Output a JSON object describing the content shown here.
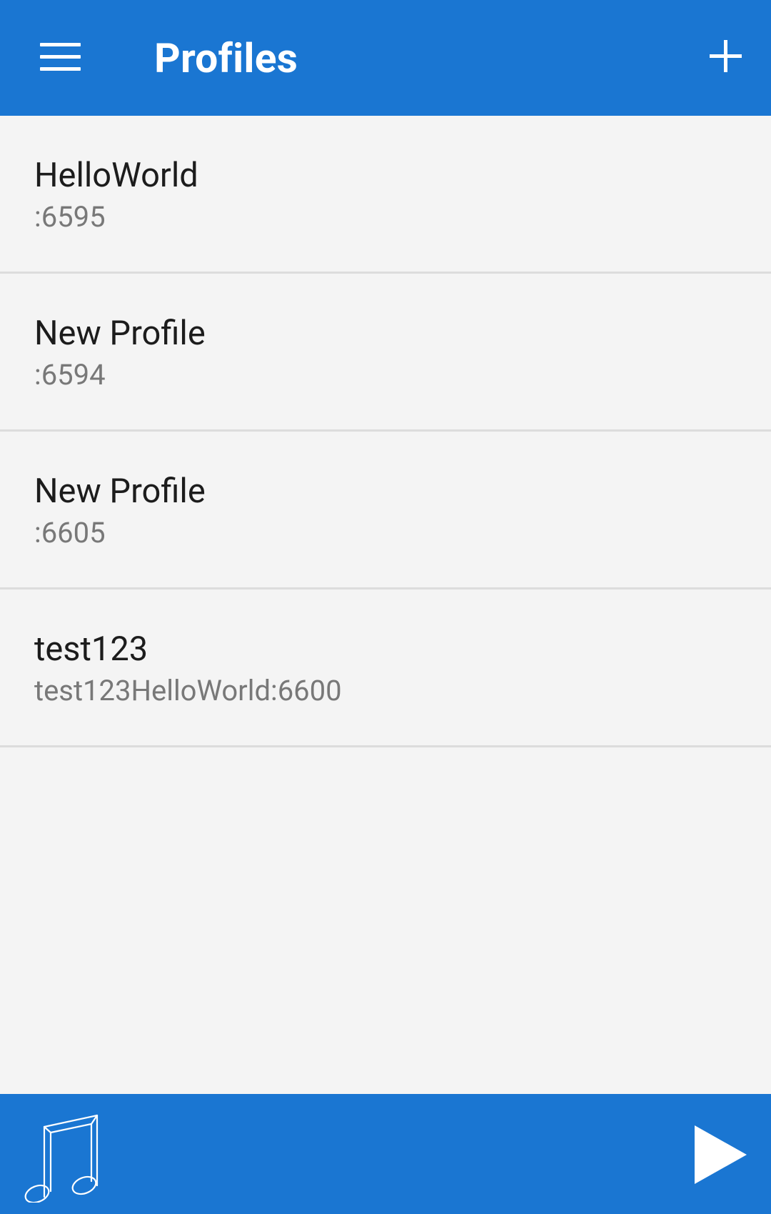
{
  "appbar": {
    "title": "Profiles",
    "menu_icon": "hamburger-menu-icon",
    "add_icon": "plus-icon"
  },
  "profiles": [
    {
      "name": "HelloWorld",
      "detail": ":6595"
    },
    {
      "name": "New Profile",
      "detail": ":6594"
    },
    {
      "name": "New Profile",
      "detail": ":6605"
    },
    {
      "name": "test123",
      "detail": "test123HelloWorld:6600"
    }
  ],
  "bottombar": {
    "left_icon": "music-note-icon",
    "right_icon": "play-icon"
  },
  "colors": {
    "primary": "#1a76d2",
    "background": "#f4f4f4",
    "divider": "#dcdcdc",
    "name_text": "#1c1c1c",
    "detail_text": "#787878"
  }
}
